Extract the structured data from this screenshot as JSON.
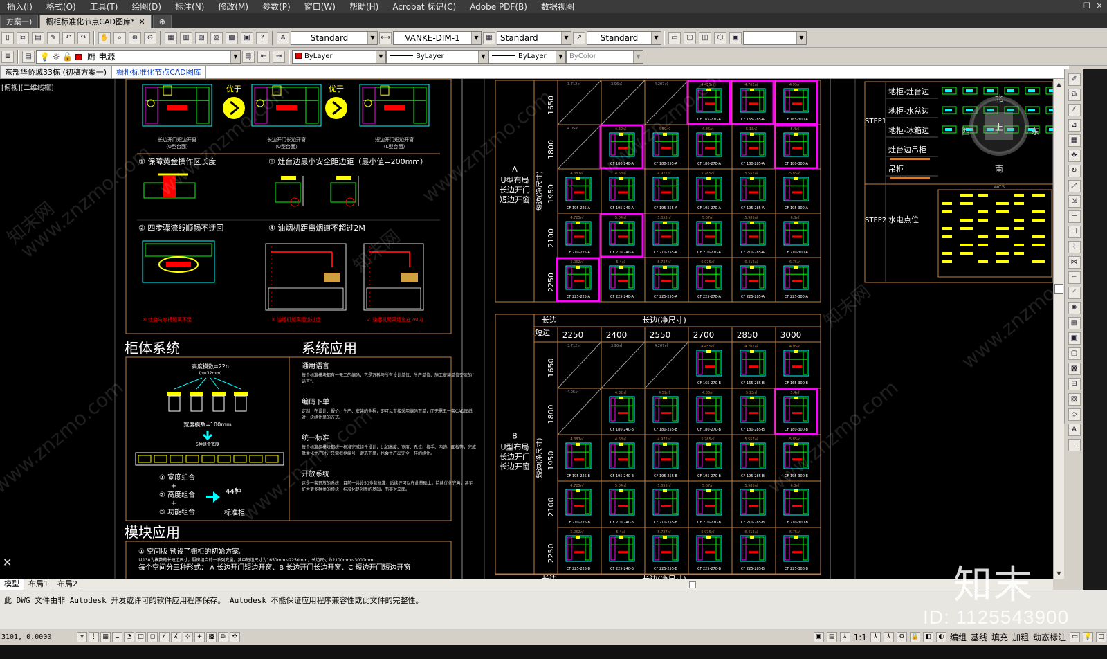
{
  "menu": [
    "插入(I)",
    "格式(O)",
    "工具(T)",
    "绘图(D)",
    "标注(N)",
    "修改(M)",
    "参数(P)",
    "窗口(W)",
    "帮助(H)",
    "Acrobat 标记(C)",
    "Adobe PDF(B)",
    "数据视图"
  ],
  "file_tabs": [
    {
      "label": "方案一)",
      "active": false
    },
    {
      "label": "橱柜标准化节点CAD图库*",
      "active": true
    }
  ],
  "toolbar1": {
    "text_style": "Standard",
    "dim_style": "VANKE-DIM-1",
    "table_style": "Standard",
    "mleader_style": "Standard",
    "last_combo": ""
  },
  "toolbar2": {
    "layer": "厨-电源",
    "color": "ByLayer",
    "linetype": "ByLayer",
    "lineweight": "ByLayer",
    "plotstyle": "ByColor"
  },
  "doc_tabs": [
    {
      "label": "东部华侨城33栋 (初稿方案一)",
      "active": false
    },
    {
      "label": "橱柜标准化节点CAD图库",
      "active": true
    }
  ],
  "viewport_label": "[俯视][二维线框]",
  "drawing": {
    "left": {
      "compare_label": "优于",
      "sub_captions": [
        "长边开门短边开窗\n（U型台面）",
        "长边开门长边开窗\n（U型台面）",
        "短边开门短边开窗\n（L型台面）"
      ],
      "rules": [
        "① 保障黄金操作区长度",
        "③ 灶台边最小安全距边距（最小值=200mm）",
        "② 四步骤流线顺畅不迂回",
        "④ 油烟机距离烟道不超过2M"
      ],
      "notes": [
        "✕ 灶台与水槽距离不足",
        "✕ 油烟机距离烟道过远",
        "✓ 油烟机距离烟道在2M内"
      ],
      "section1": "柜体系统",
      "section2": "系统应用",
      "section3": "模块应用",
      "height_note": "高度模数=22n",
      "height_sub": "(n=32mm)",
      "width_note": "宽度模数=100mm",
      "width_sub": "5种组合宽度",
      "combos": [
        "① 宽度组合",
        "② 高度组合",
        "③ 功能组合"
      ],
      "combo_result": "44种",
      "combo_result2": "标准柜",
      "apps": [
        {
          "title": "通用语言",
          "body": "每个标准模块都有一无二的编码，它是万科与所有设计单位、生产单位、施工安装单位交流的“语言”。"
        },
        {
          "title": "编码下单",
          "body": "定制，在设计、报价、生产、安装的全程，即可以直接采用编码下单，而无需五一套CAD图纸对一块组件单的方式。"
        },
        {
          "title": "统一标准",
          "body": "每个标准组模块都统一标准完成组件设计，比如高度、宽度、孔位、拉手、内饰、面板等，完成批量化生产时，只需根据编号一键选下单，也会生产出完全一样的组件。"
        },
        {
          "title": "开放系统",
          "body": "这是一套开放的系统，目前一共设50多款标准，后续还可以在此基础上，持续优化完善，甚至扩大更多种类的模块，标准化是创新的基础，而非对立面。"
        }
      ],
      "module_title": "① 空间版  预设了橱柜的初始方案。",
      "module_sub": "以130为模数的长短边尺寸，厨房组合的一系列变量。其中短边尺寸为1650mm~2250mm；长边尺寸为2100mm~3000mm。",
      "module_forms": "每个空间分三种形式：  A 长边开门短边开窗、B 长边开门长边开窗、C 短边开门短边开窗"
    },
    "grid": {
      "long_edge": "长边",
      "long_edge_net": "长边(净尺寸)",
      "short_edge": "短边",
      "short_edge_net": "短边(净尺寸)",
      "cols": [
        "2250",
        "2400",
        "2550",
        "2700",
        "2850",
        "3000"
      ],
      "rows": [
        "1650",
        "1800",
        "1950",
        "2100",
        "2250"
      ],
      "group_a": {
        "letter": "A",
        "desc": "U型布局\n长边开门\n短边开窗"
      },
      "group_b": {
        "letter": "B",
        "desc": "U型布局\n长边开门\n长边开窗"
      },
      "codes_a": [
        [
          "",
          "",
          "",
          "CF 165-270-A",
          "CF 165-285-A",
          "CF 165-300-A"
        ],
        [
          "",
          "CF 180-240-A",
          "CF 180-255-A",
          "CF 180-270-A",
          "CF 180-285-A",
          "CF 180-300-A"
        ],
        [
          "CF 195-225-A",
          "CF 195-240-A",
          "CF 195-255-A",
          "CF 195-270-A",
          "CF 195-285-A",
          "CF 195-300-A"
        ],
        [
          "CF 210-225-A",
          "CF 210-240-A",
          "CF 210-255-A",
          "CF 210-270-A",
          "CF 210-285-A",
          "CF 210-300-A"
        ],
        [
          "CF 225-225-A",
          "CF 225-240-A",
          "CF 225-255-A",
          "CF 225-270-A",
          "CF 225-285-A",
          "CF 225-300-A"
        ]
      ],
      "codes_b": [
        [
          "",
          "",
          "",
          "CF 165-270-B",
          "CF 165-285-B",
          "CF 165-300-B"
        ],
        [
          "",
          "CF 180-240-B",
          "CF 180-255-B",
          "CF 180-270-B",
          "CF 180-285-B",
          "CF 180-300-B"
        ],
        [
          "CF 195-225-B",
          "CF 195-240-B",
          "CF 195-255-B",
          "CF 195-270-B",
          "CF 195-285-B",
          "CF 195-300-B"
        ],
        [
          "CF 210-225-B",
          "CF 210-240-B",
          "CF 210-255-B",
          "CF 210-270-B",
          "CF 210-285-B",
          "CF 210-300-B"
        ],
        [
          "CF 225-225-B",
          "CF 225-240-B",
          "CF 225-255-B",
          "CF 225-270-B",
          "CF 225-285-B",
          "CF 225-300-B"
        ]
      ],
      "areas": [
        [
          "3.712㎡",
          "3.96㎡",
          "4.207㎡",
          "4.455㎡",
          "4.702㎡",
          "4.95㎡"
        ],
        [
          "4.05㎡",
          "4.32㎡",
          "4.59㎡",
          "4.86㎡",
          "5.13㎡",
          "5.4㎡"
        ],
        [
          "4.387㎡",
          "4.68㎡",
          "4.972㎡",
          "5.265㎡",
          "5.557㎡",
          "5.85㎡"
        ],
        [
          "4.725㎡",
          "5.04㎡",
          "5.355㎡",
          "5.67㎡",
          "5.985㎡",
          "6.3㎡"
        ],
        [
          "5.062㎡",
          "5.4㎡",
          "5.737㎡",
          "6.075㎡",
          "6.412㎡",
          "6.75㎡"
        ]
      ],
      "highlighted_a": [
        "0-3",
        "0-4",
        "0-5",
        "1-1",
        "1-5",
        "3-1",
        "4-0"
      ],
      "highlighted_b": [
        "1-5"
      ]
    },
    "right": {
      "step1": "STEP1",
      "step2": "STEP2",
      "step1_items": [
        "地柜-灶台边",
        "地柜-水盆边",
        "地柜-冰箱边",
        "灶台边吊柜",
        "吊柜"
      ],
      "step2_item": "水电点位",
      "compass": {
        "n": "北",
        "s": "南",
        "e": "东",
        "w": "西",
        "c": "上",
        "wcs": "WCS"
      }
    }
  },
  "layout_tabs": [
    "模型",
    "布局1",
    "布局2"
  ],
  "command_line": "此 DWG 文件由非 Autodesk 开发或许可的软件应用程序保存。  Autodesk 不能保证应用程序兼容性或此文件的完整性。",
  "status": {
    "coords": "3101, 0.0000",
    "scale": "1:1",
    "buttons": [
      "编组",
      "基线",
      "填充",
      "加粗",
      "动态标注"
    ]
  },
  "watermark": {
    "brand": "知末",
    "id": "ID: 1125543900",
    "site": "www.znzmo.com",
    "site_cn": "知末网"
  },
  "colors": {
    "cad_bg": "#000000",
    "yellow": "#ffff00",
    "green": "#00ff00",
    "magenta": "#ff00ff",
    "cyan": "#00ffff",
    "red": "#ff0000",
    "frame": "#c08040"
  }
}
